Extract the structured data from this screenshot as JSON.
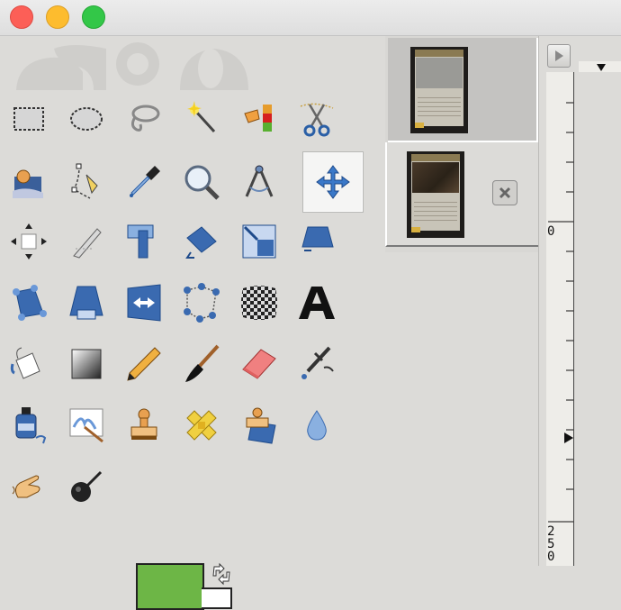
{
  "window": {
    "traffic_lights": {
      "close": {
        "color": "#fc5f57"
      },
      "minimize": {
        "color": "#fdbc2e"
      },
      "zoom": {
        "color": "#33c748"
      }
    }
  },
  "toolbox": {
    "tools": [
      {
        "name": "rect-select-tool",
        "icon": "rect-select-icon"
      },
      {
        "name": "ellipse-select-tool",
        "icon": "ellipse-select-icon"
      },
      {
        "name": "free-select-tool",
        "icon": "lasso-icon"
      },
      {
        "name": "fuzzy-select-tool",
        "icon": "magic-wand-icon"
      },
      {
        "name": "by-color-select-tool",
        "icon": "select-by-color-icon"
      },
      {
        "name": "scissors-select-tool",
        "icon": "scissors-icon"
      },
      {
        "name": "foreground-select-tool",
        "icon": "foreground-select-icon"
      },
      {
        "name": "paths-tool",
        "icon": "pen-path-icon"
      },
      {
        "name": "color-picker-tool",
        "icon": "eyedropper-icon"
      },
      {
        "name": "zoom-tool",
        "icon": "magnifier-icon"
      },
      {
        "name": "measure-tool",
        "icon": "compass-icon"
      },
      {
        "name": "move-tool",
        "icon": "move-arrows-icon",
        "active": true
      },
      {
        "name": "alignment-tool",
        "icon": "align-icon"
      },
      {
        "name": "crop-tool",
        "icon": "crop-knife-icon"
      },
      {
        "name": "rotate-tool",
        "icon": "rotate-icon"
      },
      {
        "name": "scale-tool",
        "icon": "scale-icon"
      },
      {
        "name": "shear-tool",
        "icon": "shear-icon"
      },
      {
        "name": "perspective-tool",
        "icon": "perspective-icon"
      },
      {
        "name": "unified-transform-tool",
        "icon": "unified-transform-icon"
      },
      {
        "name": "perspective-clone-tool",
        "icon": "perspective-clone-icon"
      },
      {
        "name": "flip-tool",
        "icon": "flip-icon"
      },
      {
        "name": "cage-transform-tool",
        "icon": "cage-icon"
      },
      {
        "name": "warp-transform-tool",
        "icon": "warp-icon"
      },
      {
        "name": "text-tool",
        "icon": "text-a-icon"
      },
      {
        "name": "bucket-fill-tool",
        "icon": "paint-bucket-icon"
      },
      {
        "name": "blend-tool",
        "icon": "gradient-icon"
      },
      {
        "name": "pencil-tool",
        "icon": "pencil-icon"
      },
      {
        "name": "paintbrush-tool",
        "icon": "paintbrush-icon"
      },
      {
        "name": "eraser-tool",
        "icon": "eraser-icon"
      },
      {
        "name": "airbrush-tool",
        "icon": "airbrush-icon"
      },
      {
        "name": "ink-tool",
        "icon": "ink-icon"
      },
      {
        "name": "mypaint-brush-tool",
        "icon": "mypaint-brush-icon"
      },
      {
        "name": "clone-tool",
        "icon": "clone-stamp-icon"
      },
      {
        "name": "heal-tool",
        "icon": "bandage-icon"
      },
      {
        "name": "perspective-clone-stamp-tool",
        "icon": "perspective-clone-stamp-icon"
      },
      {
        "name": "blur-sharpen-tool",
        "icon": "water-drop-icon"
      },
      {
        "name": "smudge-tool",
        "icon": "smudge-finger-icon"
      },
      {
        "name": "dodge-burn-tool",
        "icon": "dodge-burn-icon"
      }
    ],
    "foreground_color": "#6db646",
    "background_color": "#ffffff"
  },
  "images_panel": {
    "images": [
      {
        "label": "image-thumbnail-1",
        "selected": true
      },
      {
        "label": "image-thumbnail-2",
        "selected": false
      }
    ]
  },
  "canvas": {
    "ruler_labels": [
      "0",
      "2",
      "5",
      "0"
    ]
  }
}
